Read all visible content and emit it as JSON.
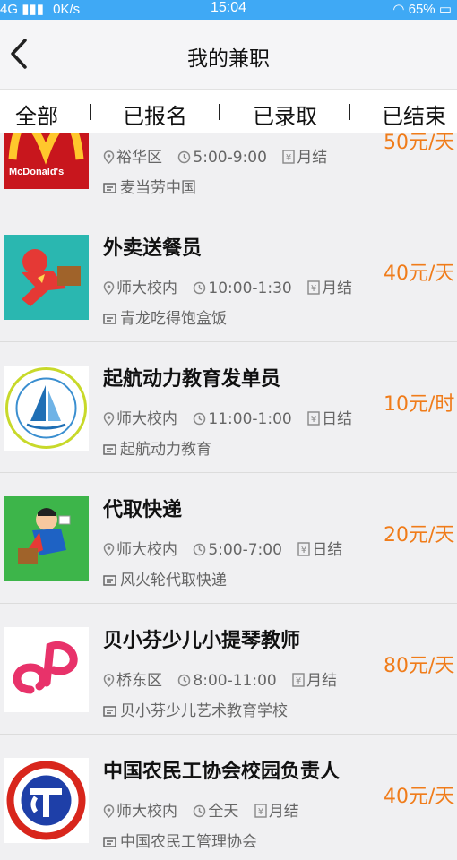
{
  "status_bar": {
    "network": "4G",
    "speed": "0K/s",
    "time": "15:04",
    "battery": "65%"
  },
  "nav": {
    "title": "我的兼职"
  },
  "tabs": [
    {
      "label": "全部"
    },
    {
      "label": "已报名"
    },
    {
      "label": "已录取"
    },
    {
      "label": "已结束"
    }
  ],
  "jobs": [
    {
      "title": "",
      "location": "裕华区",
      "hours": "5:00-9:00",
      "settlement": "月结",
      "company": "麦当劳中国",
      "pay": "50元/天",
      "logo": "mcdonalds-logo",
      "logo_text": "McDonald's"
    },
    {
      "title": "外卖送餐员",
      "location": "师大校内",
      "hours": "10:00-1:30",
      "settlement": "月结",
      "company": "青龙吃得饱盒饭",
      "pay": "40元/天",
      "logo": "delivery-hero-logo"
    },
    {
      "title": "起航动力教育发单员",
      "location": "师大校内",
      "hours": "11:00-1:00",
      "settlement": "日结",
      "company": "起航动力教育",
      "pay": "10元/时",
      "logo": "sail-circle-logo"
    },
    {
      "title": "代取快递",
      "location": "师大校内",
      "hours": "5:00-7:00",
      "settlement": "日结",
      "company": "风火轮代取快递",
      "pay": "20元/天",
      "logo": "superhero-courier-logo"
    },
    {
      "title": "贝小芬少儿小提琴教师",
      "location": "桥东区",
      "hours": "8:00-11:00",
      "settlement": "月结",
      "company": "贝小芬少儿艺术教育学校",
      "pay": "80元/天",
      "logo": "music-note-logo"
    },
    {
      "title": "中国农民工协会校园负责人",
      "location": "师大校内",
      "hours": "全天",
      "settlement": "月结",
      "company": "中国农民工管理协会",
      "pay": "40元/天",
      "logo": "gear-emblem-logo"
    }
  ],
  "colors": {
    "status_bar": "#3fa9f5",
    "pay": "#f07c1a",
    "list_bg": "#f0f0f2"
  }
}
